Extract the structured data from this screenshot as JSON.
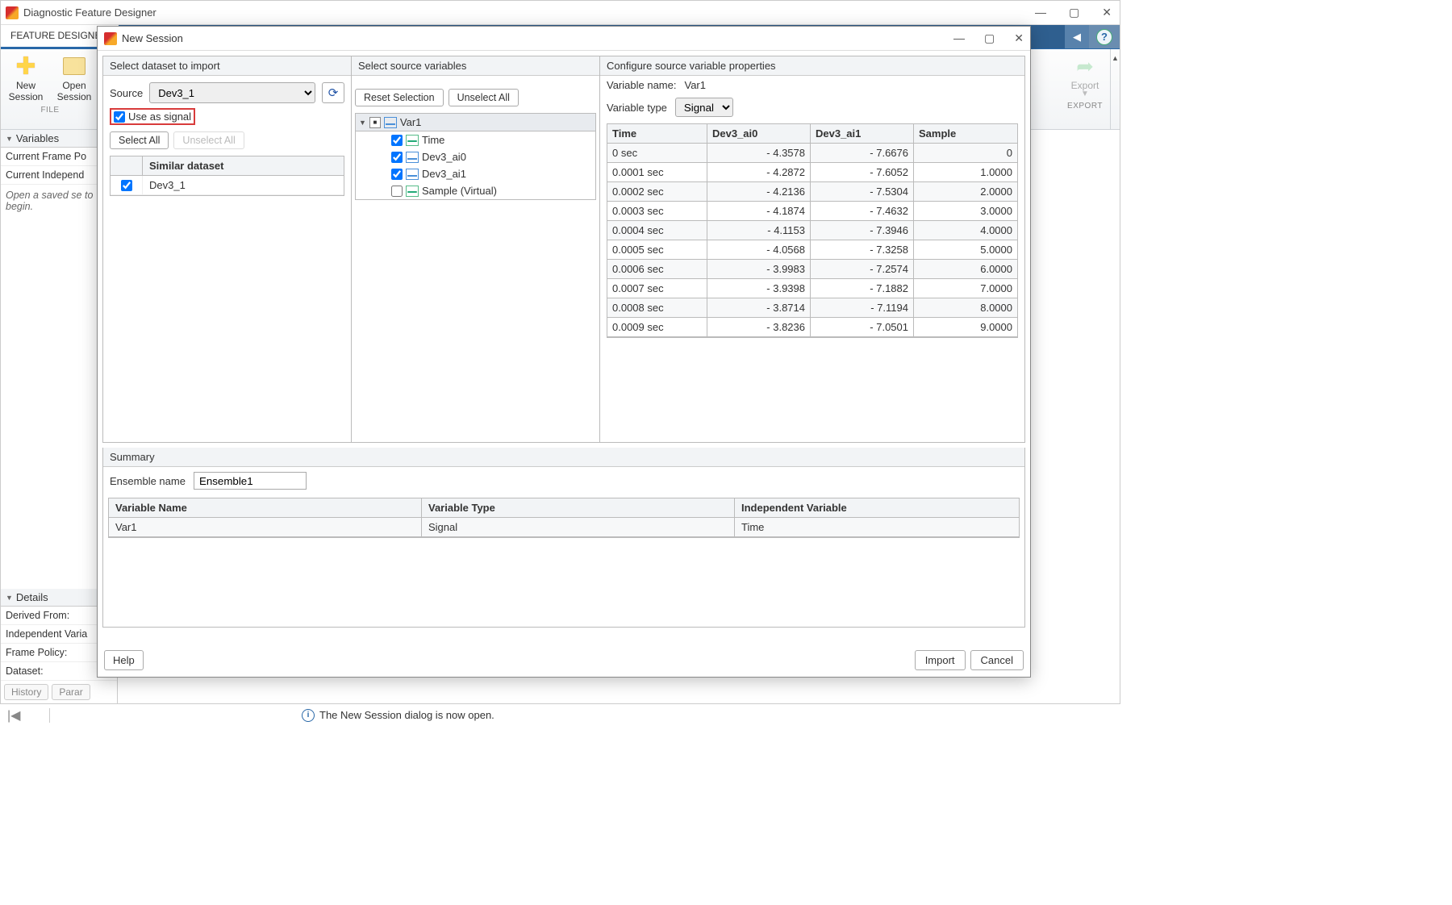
{
  "outer": {
    "title": "Diagnostic Feature Designer",
    "ribbon_tab": "FEATURE DESIGNER",
    "file_group": "FILE",
    "export_group": "EXPORT",
    "tool_new1": "New",
    "tool_new2": "Session",
    "tool_open1": "Open",
    "tool_open2": "Session",
    "tool_export": "Export"
  },
  "side": {
    "variables_title": "Variables",
    "items": [
      "Current Frame Po",
      "Current Independ"
    ],
    "open_msg": "Open a saved se to begin.",
    "details_title": "Details",
    "details_items": [
      "Derived From:",
      "Independent Varia",
      "Frame Policy:",
      "Dataset:"
    ],
    "tabs": [
      "History",
      "Parar"
    ]
  },
  "status": {
    "text": "The New Session dialog is now open."
  },
  "modal": {
    "title": "New Session",
    "col1_title": "Select dataset to import",
    "source_label": "Source",
    "source_value": "Dev3_1",
    "use_signal": "Use as signal",
    "select_all": "Select All",
    "unselect_all": "Unselect All",
    "ds_header": "Similar dataset",
    "ds_rows": [
      "Dev3_1"
    ],
    "col2_title": "Select source variables",
    "reset_btn": "Reset Selection",
    "unselect_btn": "Unselect All",
    "tree_root": "Var1",
    "tree_items": [
      {
        "label": "Time",
        "checked": true,
        "kind": "time"
      },
      {
        "label": "Dev3_ai0",
        "checked": true,
        "kind": "signal"
      },
      {
        "label": "Dev3_ai1",
        "checked": true,
        "kind": "signal"
      },
      {
        "label": "Sample (Virtual)",
        "checked": false,
        "kind": "time"
      }
    ],
    "col3_title": "Configure source variable properties",
    "varname_label": "Variable name:",
    "varname_value": "Var1",
    "vartype_label": "Variable type",
    "vartype_value": "Signal",
    "table_headers": [
      "Time",
      "Dev3_ai0",
      "Dev3_ai1",
      "Sample"
    ],
    "table_rows": [
      [
        "0 sec",
        "- 4.3578",
        "- 7.6676",
        "0"
      ],
      [
        "0.0001 sec",
        "- 4.2872",
        "- 7.6052",
        "1.0000"
      ],
      [
        "0.0002 sec",
        "- 4.2136",
        "- 7.5304",
        "2.0000"
      ],
      [
        "0.0003 sec",
        "- 4.1874",
        "- 7.4632",
        "3.0000"
      ],
      [
        "0.0004 sec",
        "- 4.1153",
        "- 7.3946",
        "4.0000"
      ],
      [
        "0.0005 sec",
        "- 4.0568",
        "- 7.3258",
        "5.0000"
      ],
      [
        "0.0006 sec",
        "- 3.9983",
        "- 7.2574",
        "6.0000"
      ],
      [
        "0.0007 sec",
        "- 3.9398",
        "- 7.1882",
        "7.0000"
      ],
      [
        "0.0008 sec",
        "- 3.8714",
        "- 7.1194",
        "8.0000"
      ],
      [
        "0.0009 sec",
        "- 3.8236",
        "- 7.0501",
        "9.0000"
      ]
    ],
    "summary_title": "Summary",
    "ens_label": "Ensemble name",
    "ens_value": "Ensemble1",
    "vt_headers": [
      "Variable Name",
      "Variable Type",
      "Independent Variable"
    ],
    "vt_row": [
      "Var1",
      "Signal",
      "Time"
    ],
    "help_btn": "Help",
    "import_btn": "Import",
    "cancel_btn": "Cancel"
  }
}
